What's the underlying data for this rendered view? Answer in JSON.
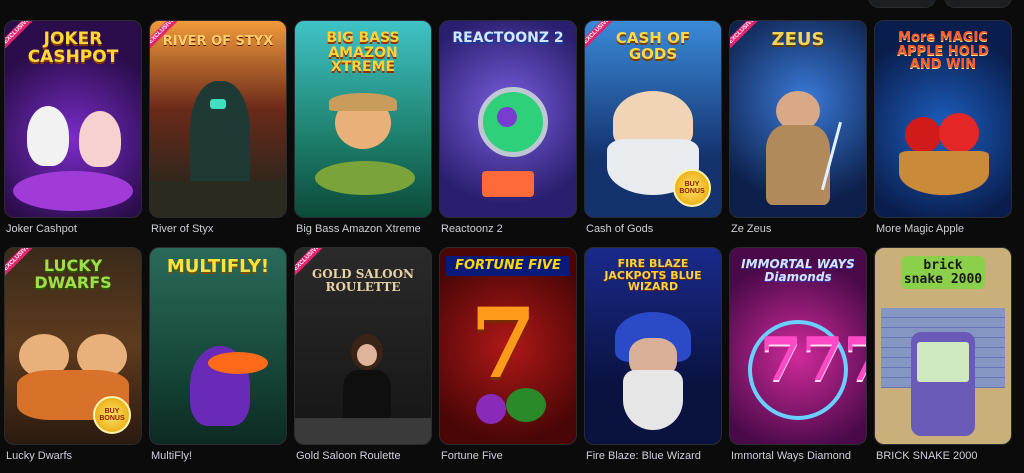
{
  "games": [
    {
      "name": "Joker Cashpot",
      "logo": "JOKER CASHPOT",
      "exclusive": true,
      "bonus": false
    },
    {
      "name": "River of Styx",
      "logo": "RIVER OF STYX",
      "exclusive": true,
      "bonus": false
    },
    {
      "name": "Big Bass Amazon Xtreme",
      "logo": "BIG BASS AMAZON XTREME",
      "exclusive": false,
      "bonus": false
    },
    {
      "name": "Reactoonz 2",
      "logo": "REACTOONZ 2",
      "exclusive": false,
      "bonus": false
    },
    {
      "name": "Cash of Gods",
      "logo": "CASH OF GODS",
      "exclusive": true,
      "bonus": true
    },
    {
      "name": "Ze Zeus",
      "logo": "ZEUS",
      "exclusive": true,
      "bonus": false
    },
    {
      "name": "More Magic Apple",
      "logo": "More MAGIC APPLE HOLD AND WIN",
      "exclusive": false,
      "bonus": false
    },
    {
      "name": "Lucky Dwarfs",
      "logo": "LUCKY DWARFS",
      "exclusive": true,
      "bonus": true
    },
    {
      "name": "MultiFly!",
      "logo": "MULTIFLY!",
      "exclusive": false,
      "bonus": false
    },
    {
      "name": "Gold Saloon Roulette",
      "logo": "GOLD SALOON ROULETTE",
      "exclusive": true,
      "bonus": false
    },
    {
      "name": "Fortune Five",
      "logo": "FORTUNE FIVE",
      "exclusive": false,
      "bonus": false
    },
    {
      "name": "Fire Blaze: Blue Wizard",
      "logo": "FIRE BLAZE JACKPOTS BLUE WIZARD",
      "exclusive": false,
      "bonus": false
    },
    {
      "name": "Immortal Ways Diamond",
      "logo": "IMMORTAL WAYS Diamonds",
      "exclusive": false,
      "bonus": false
    },
    {
      "name": "BRICK SNAKE 2000",
      "logo": "brick snake 2000",
      "exclusive": false,
      "bonus": false
    }
  ],
  "badges": {
    "exclusive": "EXCLUSIVE",
    "bonus": "BUY BONUS"
  },
  "colors": {
    "bg": "#0b0b0c",
    "tile_border": "#2b2c31",
    "label": "#cfd0d6",
    "exclusive_ribbon": "#e0246f"
  }
}
